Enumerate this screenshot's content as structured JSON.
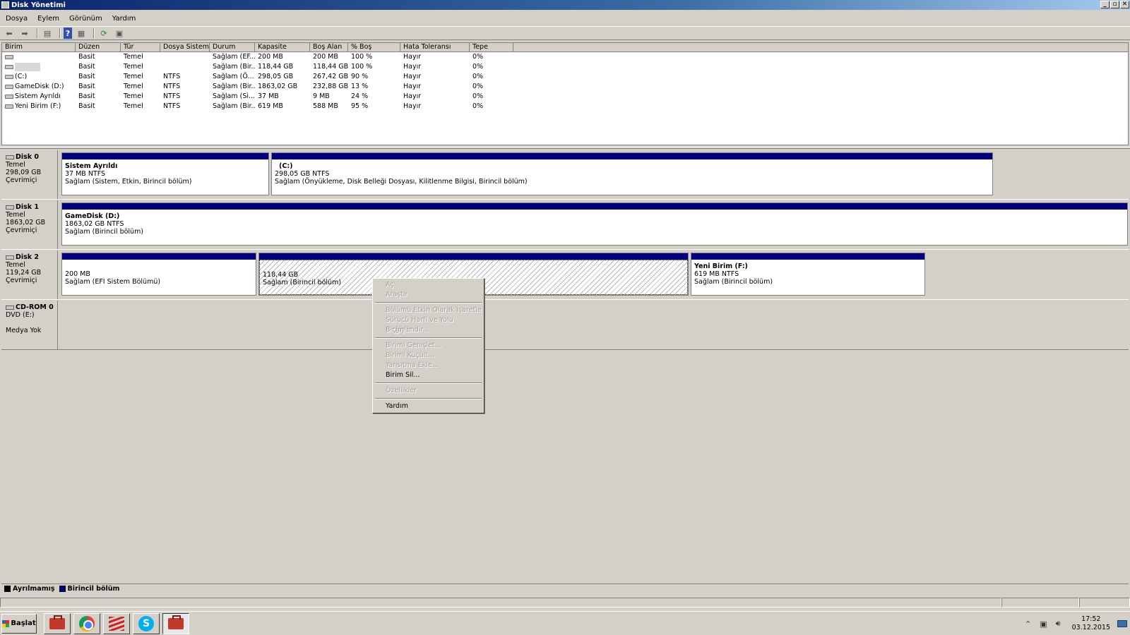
{
  "window": {
    "title": "Disk Yönetimi"
  },
  "menubar": [
    "Dosya",
    "Eylem",
    "Görünüm",
    "Yardım"
  ],
  "volume_list": {
    "columns": [
      "Birim",
      "Düzen",
      "Tür",
      "Dosya Sistemi",
      "Durum",
      "Kapasite",
      "Boş Alan",
      "% Boş",
      "Hata Toleransı",
      "Tepe"
    ],
    "rows": [
      {
        "name": "",
        "layout": "Basit",
        "type": "Temel",
        "fs": "",
        "status": "Sağlam (EF...",
        "capacity": "200 MB",
        "free": "200 MB",
        "pct": "100 %",
        "fault": "Hayır",
        "overhead": "0%"
      },
      {
        "name": "",
        "layout": "Basit",
        "type": "Temel",
        "fs": "",
        "status": "Sağlam (Bir...",
        "capacity": "118,44 GB",
        "free": "118,44 GB",
        "pct": "100 %",
        "fault": "Hayır",
        "overhead": "0%"
      },
      {
        "name": "(C:)",
        "layout": "Basit",
        "type": "Temel",
        "fs": "NTFS",
        "status": "Sağlam (Ö...",
        "capacity": "298,05 GB",
        "free": "267,42 GB",
        "pct": "90 %",
        "fault": "Hayır",
        "overhead": "0%"
      },
      {
        "name": "GameDisk (D:)",
        "layout": "Basit",
        "type": "Temel",
        "fs": "NTFS",
        "status": "Sağlam (Bir...",
        "capacity": "1863,02 GB",
        "free": "232,88 GB",
        "pct": "13 %",
        "fault": "Hayır",
        "overhead": "0%"
      },
      {
        "name": "Sistem Ayrıldı",
        "layout": "Basit",
        "type": "Temel",
        "fs": "NTFS",
        "status": "Sağlam (Si...",
        "capacity": "37 MB",
        "free": "9 MB",
        "pct": "24 %",
        "fault": "Hayır",
        "overhead": "0%"
      },
      {
        "name": "Yeni Birim (F:)",
        "layout": "Basit",
        "type": "Temel",
        "fs": "NTFS",
        "status": "Sağlam (Bir...",
        "capacity": "619 MB",
        "free": "588 MB",
        "pct": "95 %",
        "fault": "Hayır",
        "overhead": "0%"
      }
    ]
  },
  "disks": [
    {
      "name": "Disk 0",
      "type": "Temel",
      "size": "298,09 GB",
      "state": "Çevrimiçi",
      "partitions": [
        {
          "name": "Sistem Ayrıldı",
          "size": "37 MB NTFS",
          "status": "Sağlam (Sistem, Etkin, Birincil bölüm)"
        },
        {
          "name": "(C:)",
          "size": "298,05 GB NTFS",
          "status": "Sağlam (Önyükleme, Disk Belleği Dosyası, Kilitlenme Bilgisi, Birincil bölüm)"
        }
      ]
    },
    {
      "name": "Disk 1",
      "type": "Temel",
      "size": "1863,02 GB",
      "state": "Çevrimiçi",
      "partitions": [
        {
          "name": "GameDisk  (D:)",
          "size": "1863,02 GB NTFS",
          "status": "Sağlam (Birincil bölüm)"
        }
      ]
    },
    {
      "name": "Disk 2",
      "type": "Temel",
      "size": "119,24 GB",
      "state": "Çevrimiçi",
      "partitions": [
        {
          "name": "",
          "size": "200 MB",
          "status": "Sağlam (EFI Sistem Bölümü)"
        },
        {
          "name": "",
          "size": "118,44 GB",
          "status": "Sağlam (Birincil bölüm)"
        },
        {
          "name": "Yeni Birim  (F:)",
          "size": "619 MB NTFS",
          "status": "Sağlam (Birincil bölüm)"
        }
      ]
    },
    {
      "name": "CD-ROM 0",
      "type": "DVD (E:)",
      "size": "",
      "state": "Medya Yok",
      "partitions": []
    }
  ],
  "legend": [
    {
      "label": "Ayrılmamış",
      "color": "#000000"
    },
    {
      "label": "Birincil bölüm",
      "color": "#000080"
    }
  ],
  "context_menu": {
    "items": [
      {
        "label": "Aç",
        "enabled": false
      },
      {
        "label": "Araştır",
        "enabled": false
      },
      {
        "sep": true
      },
      {
        "label": "Bölümü Etkin Olarak İşaretle",
        "enabled": false
      },
      {
        "label": "Sürücü Harfi ve Yolu Değiştir...",
        "enabled": false
      },
      {
        "label": "Biçimlendir...",
        "enabled": false
      },
      {
        "sep": true
      },
      {
        "label": "Birimi Genişlet...",
        "enabled": false
      },
      {
        "label": "Birimi Küçült...",
        "enabled": false
      },
      {
        "label": "Yansıtma Ekle...",
        "enabled": false
      },
      {
        "label": "Birim Sil...",
        "enabled": true
      },
      {
        "sep": true
      },
      {
        "label": "Özellikler",
        "enabled": false
      },
      {
        "sep": true
      },
      {
        "label": "Yardım",
        "enabled": true
      }
    ]
  },
  "taskbar": {
    "start_label": "Başlat",
    "tasks": [
      "disk-management-icon",
      "chrome-icon",
      "app-stripes-icon",
      "skype-icon",
      "disk-management-active-icon"
    ],
    "clock_time": "17:52",
    "clock_date": "03.12.2015"
  },
  "colors": {
    "primary_partition": "#000080",
    "title_bar": "#0a246a"
  }
}
